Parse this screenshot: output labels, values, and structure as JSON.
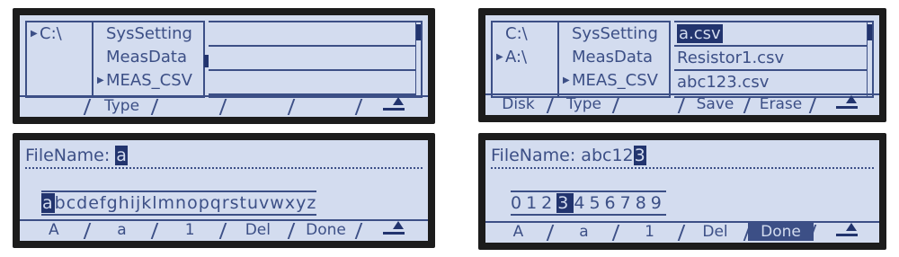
{
  "screens": [
    {
      "disks": [
        "C:\\"
      ],
      "selected_disk": 0,
      "types": [
        "SysSetting",
        "MeasData",
        "MEAS_CSV"
      ],
      "selected_type": 2,
      "files": [
        "",
        "",
        ""
      ],
      "softkeys": [
        "",
        "Type",
        "",
        "",
        "",
        ""
      ]
    },
    {
      "disks": [
        "C:\\",
        "A:\\"
      ],
      "selected_disk": 1,
      "types": [
        "SysSetting",
        "MeasData",
        "MEAS_CSV"
      ],
      "selected_type": 2,
      "files": [
        "a.csv",
        "Resistor1.csv",
        "abc123.csv"
      ],
      "selected_file": 0,
      "softkeys": [
        "Disk",
        "Type",
        "",
        "Save",
        "Erase",
        ""
      ]
    },
    {
      "filename_label": "FileName:",
      "filename_value": "",
      "filename_cursor": "a",
      "charset_before": "",
      "charset_selected": "a",
      "charset_after": "bcdefghijklmnopqrstuvwxyz",
      "softkeys": [
        "A",
        "a",
        "1",
        "Del",
        "Done",
        ""
      ]
    },
    {
      "filename_label": "FileName:",
      "filename_value": "abc12",
      "filename_cursor": "3",
      "charset_before": "012",
      "charset_selected": "3",
      "charset_after": "456789",
      "softkeys": [
        "A",
        "a",
        "1",
        "Del",
        "Done",
        ""
      ],
      "active_softkey": 4
    }
  ],
  "icons": {
    "return": "return-arrow-icon",
    "selector": "triangle-right-icon"
  },
  "colors": {
    "lcd_bg": "#d3dcef",
    "lcd_fg": "#3c4f86",
    "highlight": "#22346e",
    "bezel": "#1c1c1c"
  }
}
